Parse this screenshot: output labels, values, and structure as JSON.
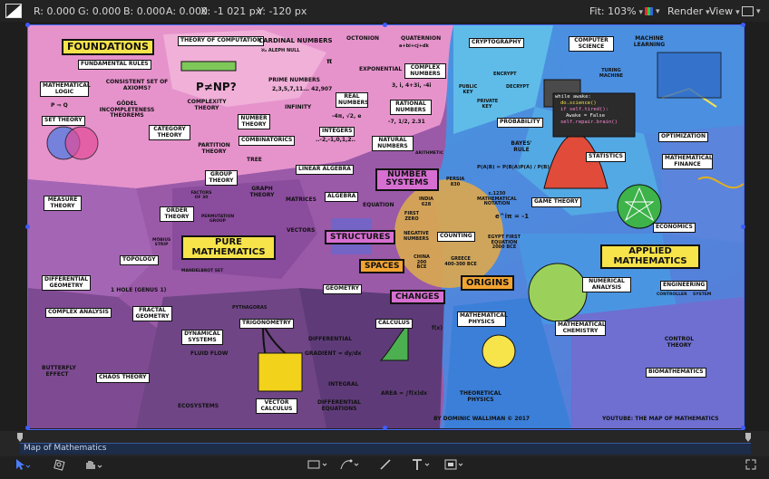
{
  "topbar": {
    "r": "R: 0.000",
    "g": "G: 0.000",
    "b": "B: 0.000",
    "a": "A: 0.000",
    "x": "X:   -1 021 px",
    "y": "Y:    -120 px",
    "fit": "Fit: 103%",
    "render": "Render",
    "view": "View"
  },
  "map": {
    "foundations": "FOUNDATIONS",
    "fundamental_rules": "FUNDAMENTAL RULES",
    "theory_of_computation": "THEORY OF COMPUTATION",
    "cardinal_numbers": "CARDINAL NUMBERS",
    "aleph": "ℵ₀ ALEPH NULL",
    "octonion": "OCTONION",
    "quaternion": "QUATERNION",
    "quaternion_sub": "a+bi+cj+dk",
    "cryptography": "CRYPTOGRAPHY",
    "computer_science": "COMPUTER SCIENCE",
    "machine_learning": "MACHINE LEARNING",
    "mathematical_logic": "MATHEMATICAL LOGIC",
    "consistent_axioms": "CONSISTENT SET OF AXIOMS?",
    "godel": "GÖDEL INCOMPLETENESS THEOREMS",
    "pnp": "P≠NP?",
    "complexity_theory": "COMPLEXITY THEORY",
    "prime_numbers": "PRIME NUMBERS",
    "primes_list": "2,3,5,7,11... 42,907",
    "pi": "π",
    "exponential": "EXPONENTIAL",
    "complex_numbers": "COMPLEX NUMBERS",
    "complex_ex": "3, i, 4+3i, -4i",
    "set_theory": "SET THEORY",
    "p_implies_q": "P ⇒ Q",
    "number_theory": "NUMBER THEORY",
    "infinity": "INFINITY",
    "real_numbers": "REAL NUMBERS",
    "real_ex": "-4π, √2, e",
    "rational_numbers": "RATIONAL NUMBERS",
    "rational_ex": "-7, 1/2, 2.31",
    "probability": "PROBABILITY",
    "turing_machine": "TURING MACHINE",
    "public_key": "PUBLIC KEY",
    "private_key": "PRIVATE KEY",
    "encrypt": "ENCRYPT",
    "decrypt": "DECRYPT",
    "code_line1": "while awake:",
    "code_line2": "do.science()",
    "code_line3": "if self.tired():",
    "code_line4": "Awake = False",
    "code_line5": "self.repair.brain()",
    "category_theory": "CATEGORY THEORY",
    "combinatorics": "COMBINATORICS",
    "integers": "INTEGERS",
    "integers_ex": "..-2,-1,0,1,2..",
    "natural_numbers": "NATURAL NUMBERS",
    "arithmetic": "ARITHMETIC",
    "optimization": "OPTIMIZATION",
    "partition_theory": "PARTITION THEORY",
    "tree": "TREE",
    "linear_algebra": "LINEAR ALGEBRA",
    "number_systems": "NUMBER SYSTEMS",
    "bayes_rule": "BAYES' RULE",
    "bayes_formula": "P(A|B) = P(B|A)P(A) / P(B)",
    "statistics": "STATISTICS",
    "mathematical_finance": "MATHEMATICAL FINANCE",
    "group_theory": "GROUP THEORY",
    "graph_theory": "GRAPH THEORY",
    "factors": "FACTORS OF 30",
    "measure_theory": "MEASURE THEORY",
    "order_theory": "ORDER THEORY",
    "permutation_group": "PERMUTATION GROUP",
    "matrices": "MATRICES",
    "algebra": "ALGEBRA",
    "equation": "EQUATION",
    "india": "INDIA 628",
    "persia": "PERSIA 830",
    "c1230": "c.1230 MATHEMATICAL NOTATION",
    "euler": "e^iπ = -1",
    "game_theory": "GAME THEORY",
    "pure_mathematics": "PURE MATHEMATICS",
    "vectors": "VECTORS",
    "structures": "STRUCTURES",
    "first_zero": "FIRST ZERO",
    "negative_numbers": "NEGATIVE NUMBERS",
    "counting": "COUNTING",
    "egypt": "EGYPT FIRST EQUATION 2000 BCE",
    "economics": "ECONOMICS",
    "applied_mathematics": "APPLIED MATHEMATICS",
    "topology": "TOPOLOGY",
    "mobius": "MÖBIUS STRIP",
    "spaces": "SPACES",
    "china": "CHINA 200 BCE",
    "greece": "GREECE 400-300 BCE",
    "origins": "ORIGINS",
    "differential_geometry": "DIFFERENTIAL GEOMETRY",
    "one_hole": "1 HOLE (GENUS 1)",
    "mandelbrot": "MANDELBROT SET",
    "geometry": "GEOMETRY",
    "numerical_analysis": "NUMERICAL ANALYSIS",
    "engineering": "ENGINEERING",
    "complex_analysis": "COMPLEX ANALYSIS",
    "fractal_geometry": "FRACTAL GEOMETRY",
    "pythagoras": "PYTHAGORAS",
    "trigonometry": "TRIGONOMETRY",
    "changes": "CHANGES",
    "calculus": "CALCULUS",
    "mathematical_physics": "MATHEMATICAL PHYSICS",
    "controller": "CONTROLLER",
    "system": "SYSTEM",
    "control_theory": "CONTROL THEORY",
    "mathematical_chemistry": "MATHEMATICAL CHEMISTRY",
    "dynamical_systems": "DYNAMICAL SYSTEMS",
    "fluid_flow": "FLUID FLOW",
    "differential": "DIFFERENTIAL",
    "gradient": "GRADIENT = dy/dx",
    "fx": "f(x)",
    "butterfly_effect": "BUTTERFLY EFFECT",
    "chaos_theory": "CHAOS THEORY",
    "biomathematics": "BIOMATHEMATICS",
    "integral": "INTEGRAL",
    "area": "AREA = ∫f(x)dx",
    "theoretical_physics": "THEORETICAL PHYSICS",
    "vector_calculus": "VECTOR CALCULUS",
    "ecosystems": "ECOSYSTEMS",
    "differential_equations": "DIFFERENTIAL EQUATIONS",
    "by": "BY DOMINIC WALLIMAN © 2017",
    "youtube": "YOUTUBE: THE MAP OF MATHEMATICS"
  },
  "timeline": {
    "clip_name": "Map of Mathematics"
  },
  "toolbar": {
    "items": [
      "select-tool",
      "transform-tool",
      "hand-tool",
      "shape-tool",
      "pen-tool",
      "brush-tool",
      "text-tool",
      "mask-tool",
      "fullscreen"
    ]
  },
  "colors": {
    "accent": "#4a6cff",
    "pink_region": "#e88ec9",
    "purple_region": "#8e4d9e",
    "blue_region": "#4aa3e0",
    "label_yellow": "#f7e34a"
  }
}
